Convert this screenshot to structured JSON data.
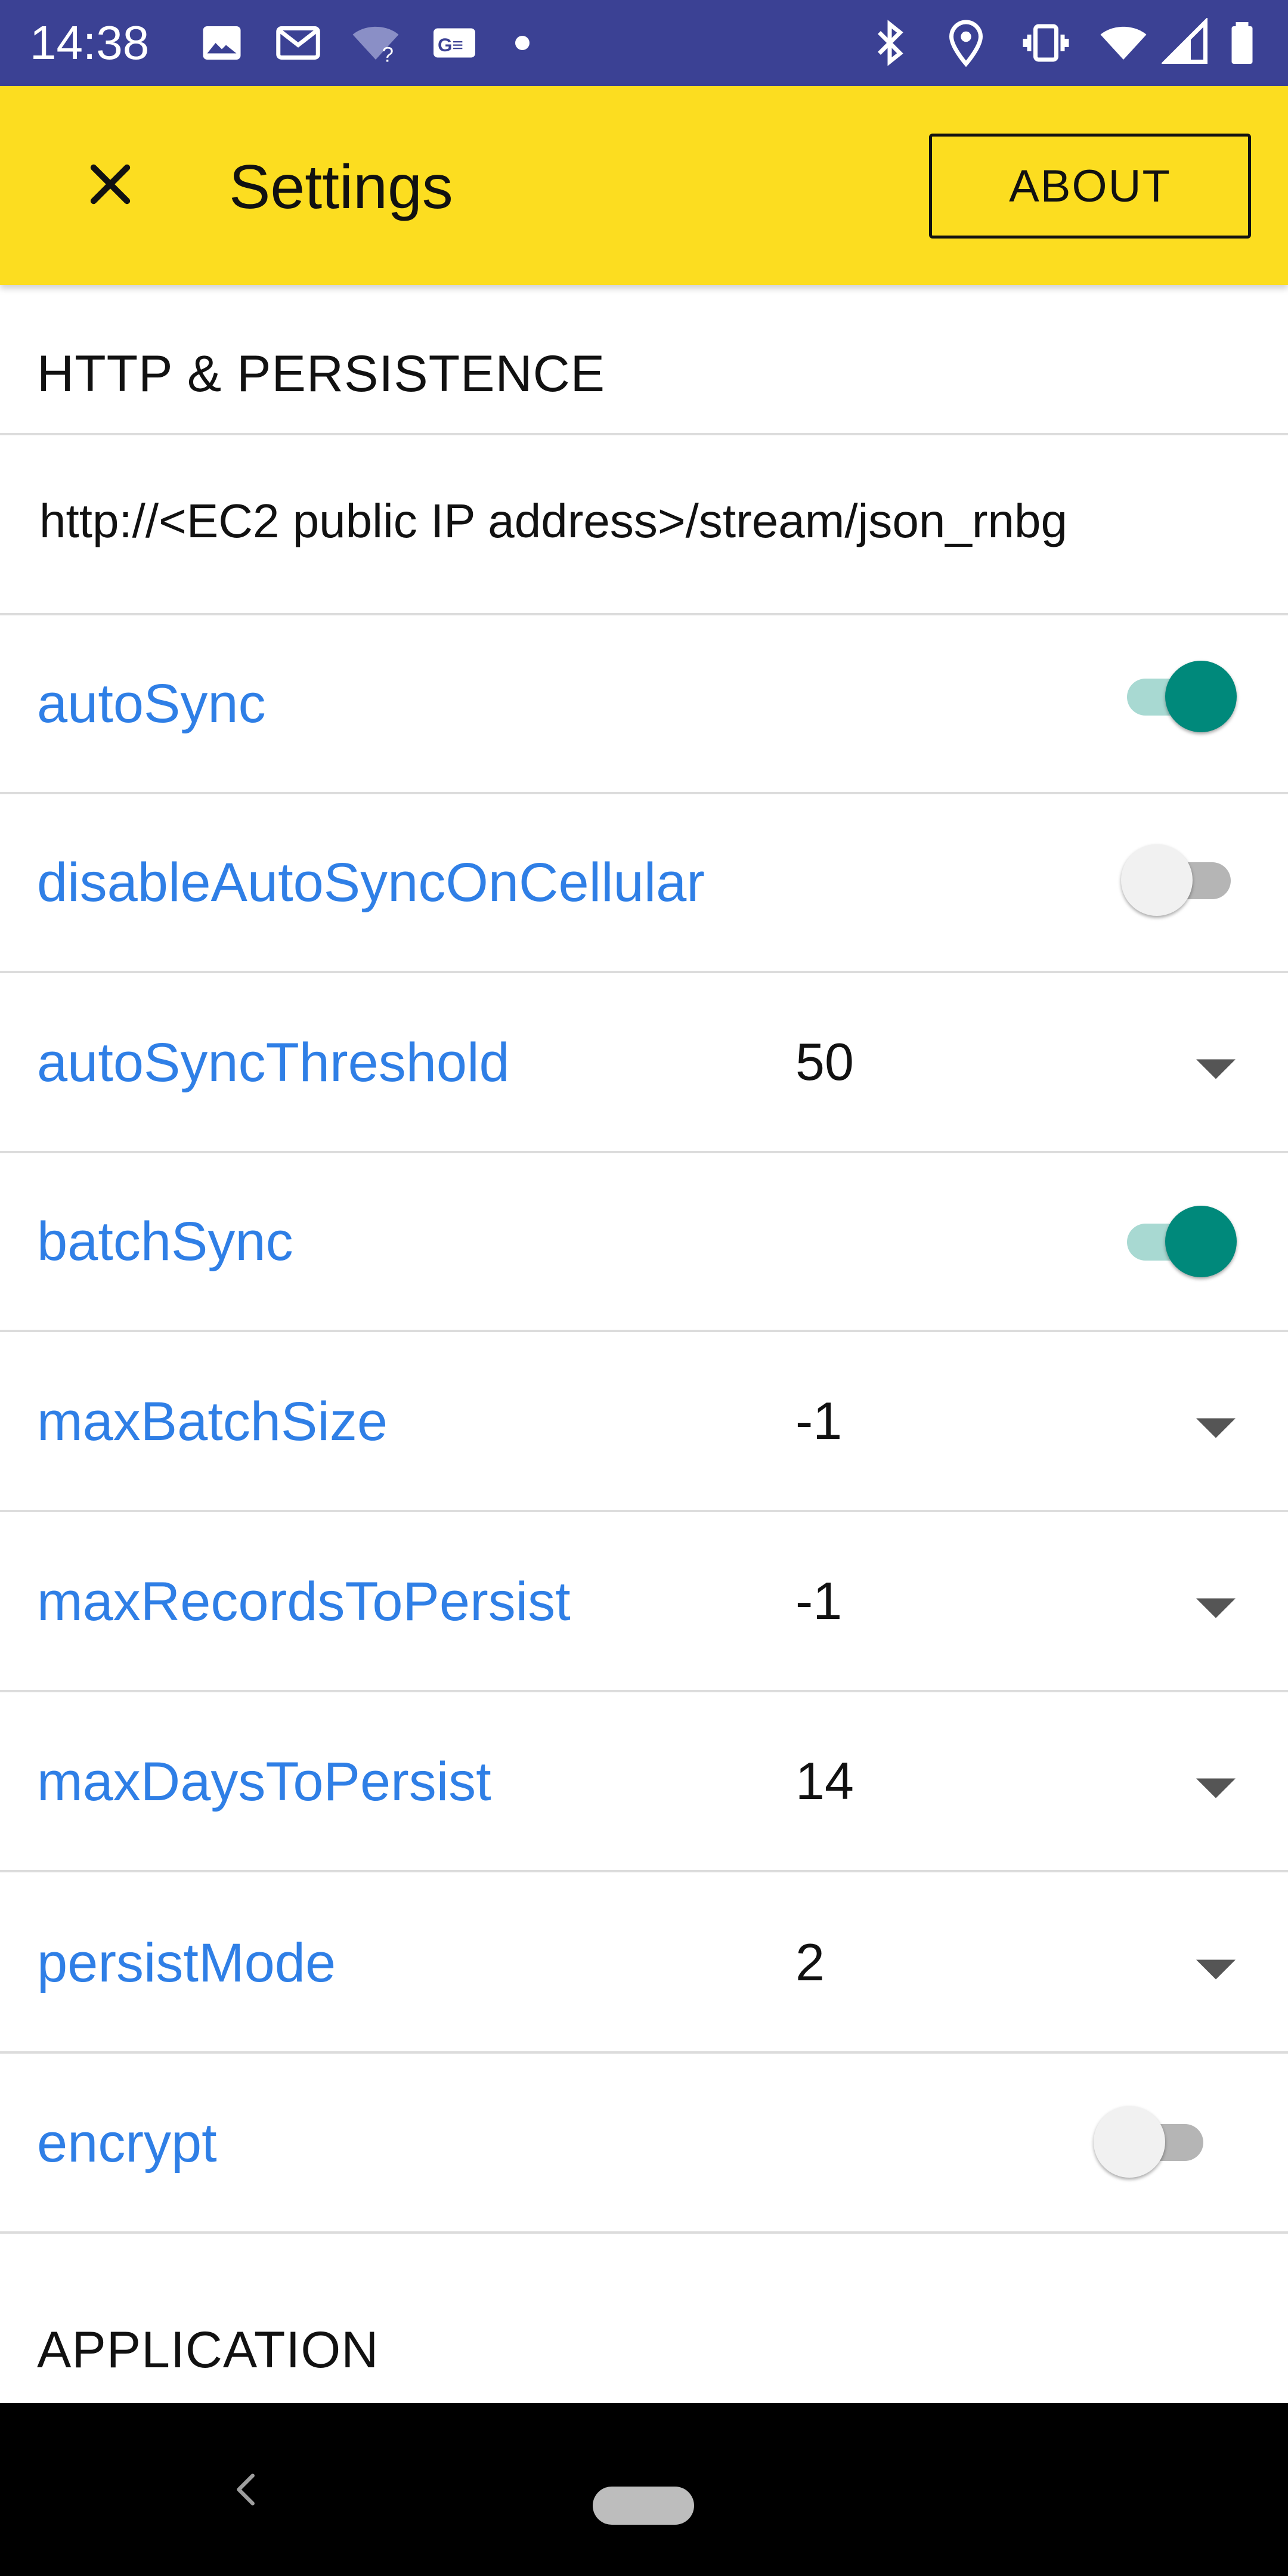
{
  "status_bar": {
    "time": "14:38",
    "left_icons": [
      "image-icon",
      "gmail-icon",
      "wifi-question-icon",
      "news-icon",
      "dot-icon"
    ],
    "right_icons": [
      "bluetooth-icon",
      "location-icon",
      "vibrate-icon",
      "wifi-icon",
      "signal-icon",
      "battery-icon"
    ]
  },
  "app_bar": {
    "close_icon": "close-icon",
    "title": "Settings",
    "about_label": "ABOUT",
    "background": "#fcdd20"
  },
  "sections": {
    "http": {
      "header": "HTTP & PERSISTENCE",
      "url": "http://<EC2 public IP address>/stream/json_rnbg"
    },
    "application": {
      "header": "APPLICATION"
    }
  },
  "settings": {
    "autoSync": {
      "label": "autoSync",
      "enabled": true
    },
    "disableAutoSyncOnCellular": {
      "label": "disableAutoSyncOnCellular",
      "enabled": false
    },
    "autoSyncThreshold": {
      "label": "autoSyncThreshold",
      "value": "50"
    },
    "batchSync": {
      "label": "batchSync",
      "enabled": true
    },
    "maxBatchSize": {
      "label": "maxBatchSize",
      "value": "-1"
    },
    "maxRecordsToPersist": {
      "label": "maxRecordsToPersist",
      "value": "-1"
    },
    "maxDaysToPersist": {
      "label": "maxDaysToPersist",
      "value": "14"
    },
    "persistMode": {
      "label": "persistMode",
      "value": "2"
    },
    "encrypt": {
      "label": "encrypt",
      "enabled": false
    }
  },
  "colors": {
    "label_blue": "#2f7fe6",
    "switch_on": "#00897b",
    "status_bar": "#3b4194"
  }
}
